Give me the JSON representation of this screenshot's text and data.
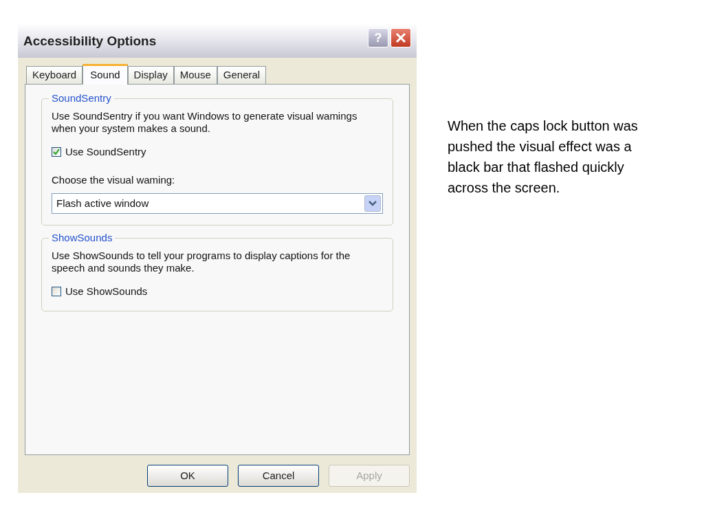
{
  "window": {
    "title": "Accessibility Options",
    "help_button": "?"
  },
  "tabs": [
    {
      "label": "Keyboard",
      "selected": false
    },
    {
      "label": "Sound",
      "selected": true
    },
    {
      "label": "Display",
      "selected": false
    },
    {
      "label": "Mouse",
      "selected": false
    },
    {
      "label": "General",
      "selected": false
    }
  ],
  "groups": [
    {
      "title": "SoundSentry",
      "description": "Use SoundSentry if you want Windows to generate visual wamings when your system makes a sound.",
      "checkbox": {
        "label": "Use SoundSentry",
        "checked": true
      },
      "dropdown": {
        "label": "Choose the visual waming:",
        "value": "Flash active window"
      }
    },
    {
      "title": "ShowSounds",
      "description": "Use ShowSounds to tell your programs to display captions for the speech and sounds they make.",
      "checkbox": {
        "label": "Use ShowSounds",
        "checked": false
      }
    }
  ],
  "buttons": [
    {
      "label": "OK",
      "disabled": false
    },
    {
      "label": "Cancel",
      "disabled": false
    },
    {
      "label": "Apply",
      "disabled": true
    }
  ],
  "note": "When the caps lock button was pushed the visual effect was a black bar that flashed quickly across the screen."
}
